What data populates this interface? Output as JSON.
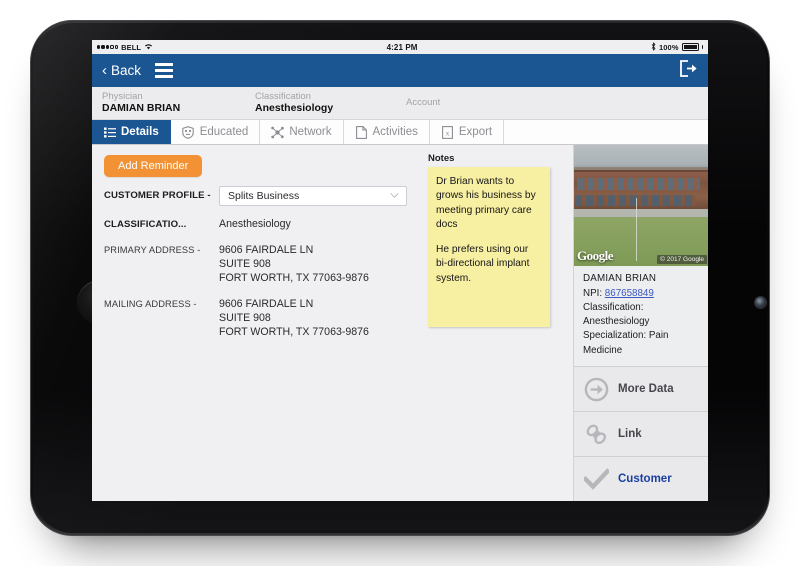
{
  "status_bar": {
    "carrier": "BELL",
    "signal_dots_filled": 3,
    "signal_dots_hollow": 2,
    "wifi_icon": "wifi-icon",
    "time": "4:21 PM",
    "bluetooth_icon": "bluetooth-icon",
    "battery_percent": "100%"
  },
  "navbar": {
    "back_label": "Back",
    "back_icon": "chevron-left-icon",
    "menu_icon": "hamburger-menu-icon",
    "logout_icon": "logout-icon",
    "background": "#1b5693"
  },
  "record_header": {
    "fields": [
      {
        "label": "Physician",
        "value": "DAMIAN BRIAN"
      },
      {
        "label": "Classification",
        "value": "Anesthesiology"
      },
      {
        "label": "Account",
        "value": ""
      }
    ]
  },
  "tabs": [
    {
      "label": "Details",
      "icon": "list-icon",
      "active": true
    },
    {
      "label": "Educated",
      "icon": "shield-icon",
      "active": false
    },
    {
      "label": "Network",
      "icon": "network-icon",
      "active": false
    },
    {
      "label": "Activities",
      "icon": "document-icon",
      "active": false
    },
    {
      "label": "Export",
      "icon": "excel-icon",
      "active": false
    }
  ],
  "details": {
    "add_reminder_label": "Add Reminder",
    "add_reminder_color": "#f29234",
    "customer_profile": {
      "label": "CUSTOMER PROFILE -",
      "selected": "Splits Business",
      "caret_icon": "chevron-down-icon"
    },
    "classification": {
      "label": "CLASSIFICATIO...",
      "value": "Anesthesiology"
    },
    "primary_address": {
      "label": "PRIMARY ADDRESS -",
      "line1": "9606 FAIRDALE LN",
      "line2": "SUITE 908",
      "line3": "FORT WORTH, TX 77063-9876"
    },
    "mailing_address": {
      "label": "MAILING ADDRESS -",
      "line1": "9606 FAIRDALE LN",
      "line2": "SUITE 908",
      "line3": "FORT WORTH, TX 77063-9876"
    }
  },
  "notes": {
    "title": "Notes",
    "paragraph_1": "Dr Brian wants to grows his business by meeting primary care docs",
    "paragraph_2": "He prefers using our bi-directional implant system.",
    "background": "#f7efa1"
  },
  "rail": {
    "street_view": {
      "provider_logo": "Google",
      "attribution": "© 2017 Google",
      "alt": "street-view-of-office-building"
    },
    "info": {
      "name": "DAMIAN BRIAN",
      "npi_label": "NPI:",
      "npi_value": "867658849",
      "classification_label": "Classification:",
      "classification_value": "Anesthesiology",
      "specialization": "Specialization: Pain Medicine"
    },
    "actions": [
      {
        "label": "More Data",
        "icon": "arrow-right-circle-icon",
        "primary": false
      },
      {
        "label": "Link",
        "icon": "chain-link-icon",
        "primary": false
      },
      {
        "label": "Customer",
        "icon": "checkmark-icon",
        "primary": true
      }
    ]
  }
}
